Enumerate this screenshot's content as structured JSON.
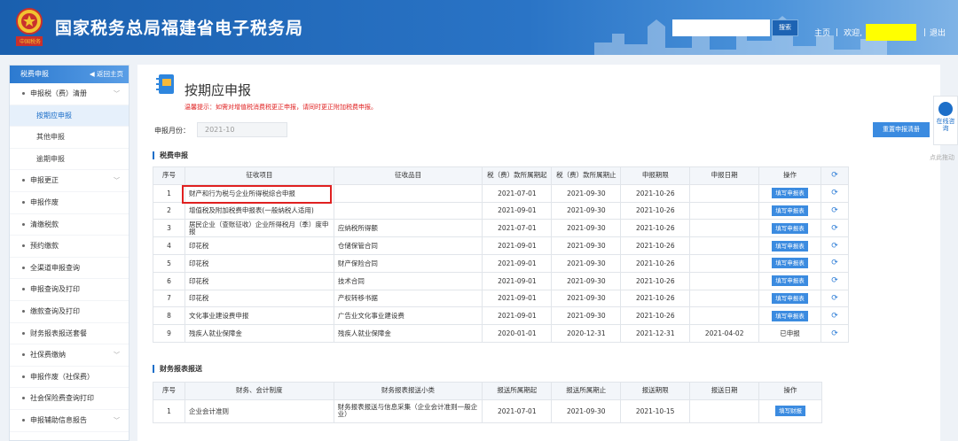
{
  "header": {
    "title": "国家税务总局福建省电子税务局",
    "emblem_text": "中国税务",
    "search_placeholder": "",
    "search_btn": "搜索",
    "home": "主页",
    "sep1": "|",
    "welcome": "欢迎,",
    "sep2": "|",
    "logout": "退出"
  },
  "sidebar": {
    "title": "税费申报",
    "back": "◀ 返回主页",
    "items": [
      {
        "label": "申报税（费）清册",
        "type": "group",
        "chev": "﹀"
      },
      {
        "label": "按期应申报",
        "type": "sub",
        "active": true
      },
      {
        "label": "其他申报",
        "type": "sub"
      },
      {
        "label": "逾期申报",
        "type": "sub"
      },
      {
        "label": "申报更正",
        "type": "group",
        "chev": "﹀"
      },
      {
        "label": "申报作废",
        "type": "group"
      },
      {
        "label": "清缴税款",
        "type": "group"
      },
      {
        "label": "预约缴款",
        "type": "group"
      },
      {
        "label": "全渠道申报查询",
        "type": "group"
      },
      {
        "label": "申报查询及打印",
        "type": "group"
      },
      {
        "label": "缴款查询及打印",
        "type": "group"
      },
      {
        "label": "财务报表报送套餐",
        "type": "group"
      },
      {
        "label": "社保费缴纳",
        "type": "group",
        "chev": "﹀"
      },
      {
        "label": "申报作废（社保费）",
        "type": "group"
      },
      {
        "label": "社会保险费查询打印",
        "type": "group"
      },
      {
        "label": "申报辅助信息报告",
        "type": "group",
        "chev": "﹀"
      }
    ]
  },
  "main": {
    "title": "按期应申报",
    "warning": "温馨提示：如需对增值税消费税更正申报，请同时更正附加税费申报。",
    "month_label": "申报月份：",
    "month_value": "2021-10",
    "reset_btn": "重置申报清册",
    "section1": "税费申报",
    "section2": "财务报表报送",
    "tax_headers": [
      "序号",
      "征收项目",
      "征收品目",
      "税（费）款所属期起",
      "税（费）款所属期止",
      "申报期限",
      "申报日期",
      "操作",
      "⟳"
    ],
    "tax_rows": [
      [
        "1",
        "财产和行为税与企业所得税综合申报",
        "",
        "2021-07-01",
        "2021-09-30",
        "2021-10-26",
        "",
        "填写申报表"
      ],
      [
        "2",
        "增值税及附加税费申报表(一般纳税人适用)",
        "",
        "2021-09-01",
        "2021-09-30",
        "2021-10-26",
        "",
        "填写申报表"
      ],
      [
        "3",
        "居民企业（查账征收）企业所得税月（季）度申报",
        "应纳税所得额",
        "2021-07-01",
        "2021-09-30",
        "2021-10-26",
        "",
        "填写申报表"
      ],
      [
        "4",
        "印花税",
        "仓储保管合同",
        "2021-09-01",
        "2021-09-30",
        "2021-10-26",
        "",
        "填写申报表"
      ],
      [
        "5",
        "印花税",
        "财产保险合同",
        "2021-09-01",
        "2021-09-30",
        "2021-10-26",
        "",
        "填写申报表"
      ],
      [
        "6",
        "印花税",
        "技术合同",
        "2021-09-01",
        "2021-09-30",
        "2021-10-26",
        "",
        "填写申报表"
      ],
      [
        "7",
        "印花税",
        "产权转移书据",
        "2021-09-01",
        "2021-09-30",
        "2021-10-26",
        "",
        "填写申报表"
      ],
      [
        "8",
        "文化事业建设费申报",
        "广告业文化事业建设费",
        "2021-09-01",
        "2021-09-30",
        "2021-10-26",
        "",
        "填写申报表"
      ],
      [
        "9",
        "残疾人就业保障金",
        "残疾人就业保障金",
        "2020-01-01",
        "2020-12-31",
        "2021-12-31",
        "2021-04-02",
        "已申报"
      ]
    ],
    "fin_headers": [
      "序号",
      "财务、会计制度",
      "财务报表报送小类",
      "报送所属期起",
      "报送所属期止",
      "报送期限",
      "报送日期",
      "操作"
    ],
    "fin_rows": [
      [
        "1",
        "企业会计准则",
        "财务报表报送与信息采集（企业会计准则一般企业）",
        "2021-07-01",
        "2021-09-30",
        "2021-10-15",
        "",
        "填写财报"
      ]
    ]
  },
  "float": {
    "chat": "在线咨询",
    "drag": "点此拖动"
  },
  "colors": {
    "accent": "#3b8be0",
    "warning": "#e02020",
    "highlight": "#ffff00"
  }
}
